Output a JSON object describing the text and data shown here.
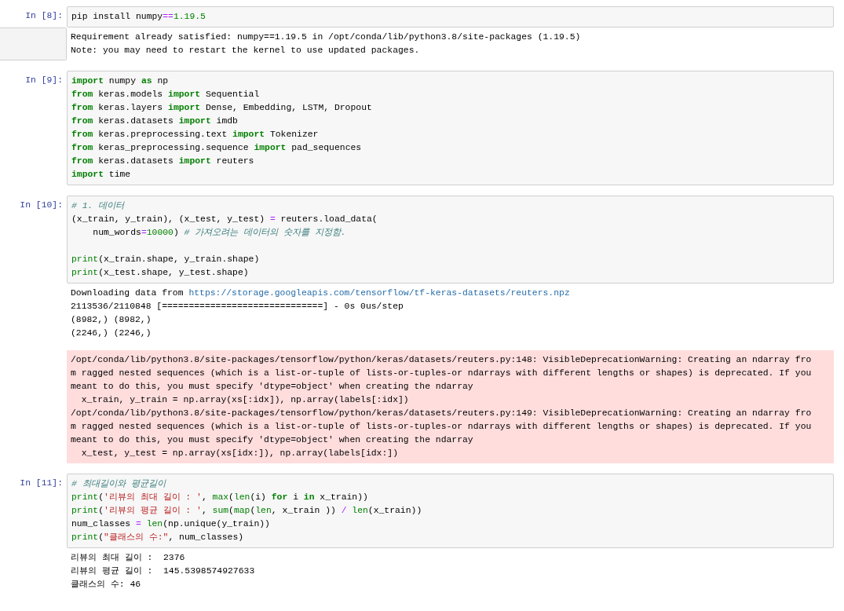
{
  "cells": [
    {
      "prompt": "In [8]:",
      "input": [
        {
          "tokens": [
            {
              "kind": "plain",
              "text": "pip install numpy"
            },
            {
              "kind": "operator",
              "text": "=="
            },
            {
              "kind": "number",
              "text": "1.19.5"
            }
          ]
        }
      ],
      "outputs": [
        {
          "kind": "stream",
          "hover": true,
          "lines": [
            {
              "tokens": [
                {
                  "kind": "plain",
                  "text": "Requirement already satisfied: numpy==1.19.5 in /opt/conda/lib/python3.8/site-packages (1.19.5)"
                }
              ]
            },
            {
              "tokens": [
                {
                  "kind": "plain",
                  "text": "Note: you may need to restart the kernel to use updated packages."
                }
              ]
            }
          ]
        }
      ]
    },
    {
      "prompt": "In [9]:",
      "input": [
        {
          "tokens": [
            {
              "kind": "keyword",
              "text": "import"
            },
            {
              "kind": "plain",
              "text": " numpy "
            },
            {
              "kind": "keyword",
              "text": "as"
            },
            {
              "kind": "plain",
              "text": " np"
            }
          ]
        },
        {
          "tokens": [
            {
              "kind": "keyword",
              "text": "from"
            },
            {
              "kind": "plain",
              "text": " keras.models "
            },
            {
              "kind": "keyword",
              "text": "import"
            },
            {
              "kind": "plain",
              "text": " Sequential"
            }
          ]
        },
        {
          "tokens": [
            {
              "kind": "keyword",
              "text": "from"
            },
            {
              "kind": "plain",
              "text": " keras.layers "
            },
            {
              "kind": "keyword",
              "text": "import"
            },
            {
              "kind": "plain",
              "text": " Dense, Embedding, LSTM, Dropout"
            }
          ]
        },
        {
          "tokens": [
            {
              "kind": "keyword",
              "text": "from"
            },
            {
              "kind": "plain",
              "text": " keras.datasets "
            },
            {
              "kind": "keyword",
              "text": "import"
            },
            {
              "kind": "plain",
              "text": " imdb"
            }
          ]
        },
        {
          "tokens": [
            {
              "kind": "keyword",
              "text": "from"
            },
            {
              "kind": "plain",
              "text": " keras.preprocessing.text "
            },
            {
              "kind": "keyword",
              "text": "import"
            },
            {
              "kind": "plain",
              "text": " Tokenizer"
            }
          ]
        },
        {
          "tokens": [
            {
              "kind": "keyword",
              "text": "from"
            },
            {
              "kind": "plain",
              "text": " keras_preprocessing.sequence "
            },
            {
              "kind": "keyword",
              "text": "import"
            },
            {
              "kind": "plain",
              "text": " pad_sequences"
            }
          ]
        },
        {
          "tokens": [
            {
              "kind": "keyword",
              "text": "from"
            },
            {
              "kind": "plain",
              "text": " keras.datasets "
            },
            {
              "kind": "keyword",
              "text": "import"
            },
            {
              "kind": "plain",
              "text": " reuters"
            }
          ]
        },
        {
          "tokens": [
            {
              "kind": "keyword",
              "text": "import"
            },
            {
              "kind": "plain",
              "text": " time"
            }
          ]
        }
      ]
    },
    {
      "prompt": "In [10]:",
      "input": [
        {
          "tokens": [
            {
              "kind": "comment",
              "text": "# 1. 데이터"
            }
          ]
        },
        {
          "tokens": [
            {
              "kind": "plain",
              "text": "(x_train, y_train), (x_test, y_test) "
            },
            {
              "kind": "operator",
              "text": "="
            },
            {
              "kind": "plain",
              "text": " reuters.load_data("
            }
          ]
        },
        {
          "tokens": [
            {
              "kind": "plain",
              "text": "    num_words"
            },
            {
              "kind": "operator",
              "text": "="
            },
            {
              "kind": "number",
              "text": "10000"
            },
            {
              "kind": "plain",
              "text": ") "
            },
            {
              "kind": "comment",
              "text": "# 가져오려는 데이터의 숫자를 지정함."
            }
          ]
        },
        {
          "space_before": true,
          "tokens": [
            {
              "kind": "builtin",
              "text": "print"
            },
            {
              "kind": "plain",
              "text": "(x_train.shape, y_train.shape)"
            }
          ]
        },
        {
          "tokens": [
            {
              "kind": "builtin",
              "text": "print"
            },
            {
              "kind": "plain",
              "text": "(x_test.shape, y_test.shape)"
            }
          ]
        }
      ],
      "outputs": [
        {
          "kind": "stream",
          "lines": [
            {
              "tokens": [
                {
                  "kind": "plain",
                  "text": "Downloading data from "
                },
                {
                  "kind": "link",
                  "text": "https://storage.googleapis.com/tensorflow/tf-keras-datasets/reuters.npz"
                }
              ]
            },
            {
              "tokens": [
                {
                  "kind": "plain",
                  "text": "2113536/2110848 [==============================] - 0s 0us/step"
                }
              ]
            },
            {
              "tokens": [
                {
                  "kind": "plain",
                  "text": "(8982,) (8982,)"
                }
              ]
            },
            {
              "tokens": [
                {
                  "kind": "plain",
                  "text": "(2246,) (2246,)"
                }
              ]
            }
          ]
        },
        {
          "kind": "stderr",
          "lines": [
            {
              "tokens": [
                {
                  "kind": "plain",
                  "text": "/opt/conda/lib/python3.8/site-packages/tensorflow/python/keras/datasets/reuters.py:148: VisibleDeprecationWarning: Creating an ndarray fro"
                }
              ]
            },
            {
              "tokens": [
                {
                  "kind": "plain",
                  "text": "m ragged nested sequences (which is a list-or-tuple of lists-or-tuples-or ndarrays with different lengths or shapes) is deprecated. If you"
                }
              ]
            },
            {
              "tokens": [
                {
                  "kind": "plain",
                  "text": "meant to do this, you must specify 'dtype=object' when creating the ndarray"
                }
              ]
            },
            {
              "tokens": [
                {
                  "kind": "plain",
                  "text": "  x_train, y_train = np.array(xs[:idx]), np.array(labels[:idx])"
                }
              ]
            },
            {
              "tokens": [
                {
                  "kind": "plain",
                  "text": "/opt/conda/lib/python3.8/site-packages/tensorflow/python/keras/datasets/reuters.py:149: VisibleDeprecationWarning: Creating an ndarray fro"
                }
              ]
            },
            {
              "tokens": [
                {
                  "kind": "plain",
                  "text": "m ragged nested sequences (which is a list-or-tuple of lists-or-tuples-or ndarrays with different lengths or shapes) is deprecated. If you"
                }
              ]
            },
            {
              "tokens": [
                {
                  "kind": "plain",
                  "text": "meant to do this, you must specify 'dtype=object' when creating the ndarray"
                }
              ]
            },
            {
              "tokens": [
                {
                  "kind": "plain",
                  "text": "  x_test, y_test = np.array(xs[idx:]), np.array(labels[idx:])"
                }
              ]
            }
          ]
        }
      ]
    },
    {
      "prompt": "In [11]:",
      "input": [
        {
          "tokens": [
            {
              "kind": "comment",
              "text": "# 최대길이와 평균길이"
            }
          ]
        },
        {
          "tokens": [
            {
              "kind": "builtin",
              "text": "print"
            },
            {
              "kind": "plain",
              "text": "("
            },
            {
              "kind": "string",
              "text": "'리뷰의 최대 길이 : '"
            },
            {
              "kind": "plain",
              "text": ", "
            },
            {
              "kind": "builtin",
              "text": "max"
            },
            {
              "kind": "plain",
              "text": "("
            },
            {
              "kind": "builtin",
              "text": "len"
            },
            {
              "kind": "plain",
              "text": "(i) "
            },
            {
              "kind": "keyword",
              "text": "for"
            },
            {
              "kind": "plain",
              "text": " i "
            },
            {
              "kind": "keyword",
              "text": "in"
            },
            {
              "kind": "plain",
              "text": " x_train))"
            }
          ]
        },
        {
          "tokens": [
            {
              "kind": "builtin",
              "text": "print"
            },
            {
              "kind": "plain",
              "text": "("
            },
            {
              "kind": "string",
              "text": "'리뷰의 평균 길이 : '"
            },
            {
              "kind": "plain",
              "text": ", "
            },
            {
              "kind": "builtin",
              "text": "sum"
            },
            {
              "kind": "plain",
              "text": "("
            },
            {
              "kind": "builtin",
              "text": "map"
            },
            {
              "kind": "plain",
              "text": "("
            },
            {
              "kind": "builtin",
              "text": "len"
            },
            {
              "kind": "plain",
              "text": ", x_train )) "
            },
            {
              "kind": "operator",
              "text": "/ "
            },
            {
              "kind": "builtin",
              "text": "len"
            },
            {
              "kind": "plain",
              "text": "(x_train))"
            }
          ]
        },
        {
          "tokens": [
            {
              "kind": "plain",
              "text": "num_classes "
            },
            {
              "kind": "operator",
              "text": "= "
            },
            {
              "kind": "builtin",
              "text": "len"
            },
            {
              "kind": "plain",
              "text": "(np.unique(y_train))"
            }
          ]
        },
        {
          "tokens": [
            {
              "kind": "builtin",
              "text": "print"
            },
            {
              "kind": "plain",
              "text": "("
            },
            {
              "kind": "string",
              "text": "\"클래스의 수:\""
            },
            {
              "kind": "plain",
              "text": ", num_classes)"
            }
          ]
        }
      ],
      "outputs": [
        {
          "kind": "stream",
          "lines": [
            {
              "tokens": [
                {
                  "kind": "plain",
                  "text": "리뷰의 최대 길이 :  2376"
                }
              ]
            },
            {
              "tokens": [
                {
                  "kind": "plain",
                  "text": "리뷰의 평균 길이 :  145.5398574927633"
                }
              ]
            },
            {
              "tokens": [
                {
                  "kind": "plain",
                  "text": "클래스의 수: 46"
                }
              ]
            }
          ]
        }
      ]
    }
  ]
}
